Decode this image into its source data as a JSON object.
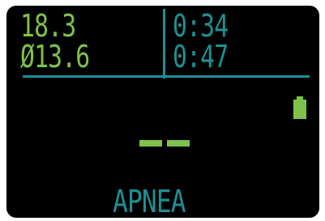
{
  "readings": {
    "top_left": "18.3",
    "bottom_left": "Ø13.6",
    "top_right": "0:34",
    "bottom_right": "0:47"
  },
  "status": {
    "battery_icon": "battery-full-icon",
    "placeholder": "--"
  },
  "mode": {
    "label": "APNEA"
  },
  "colors": {
    "background": "#000000",
    "primary_green": "#7fc24a",
    "accent_teal": "#1f8f94"
  }
}
